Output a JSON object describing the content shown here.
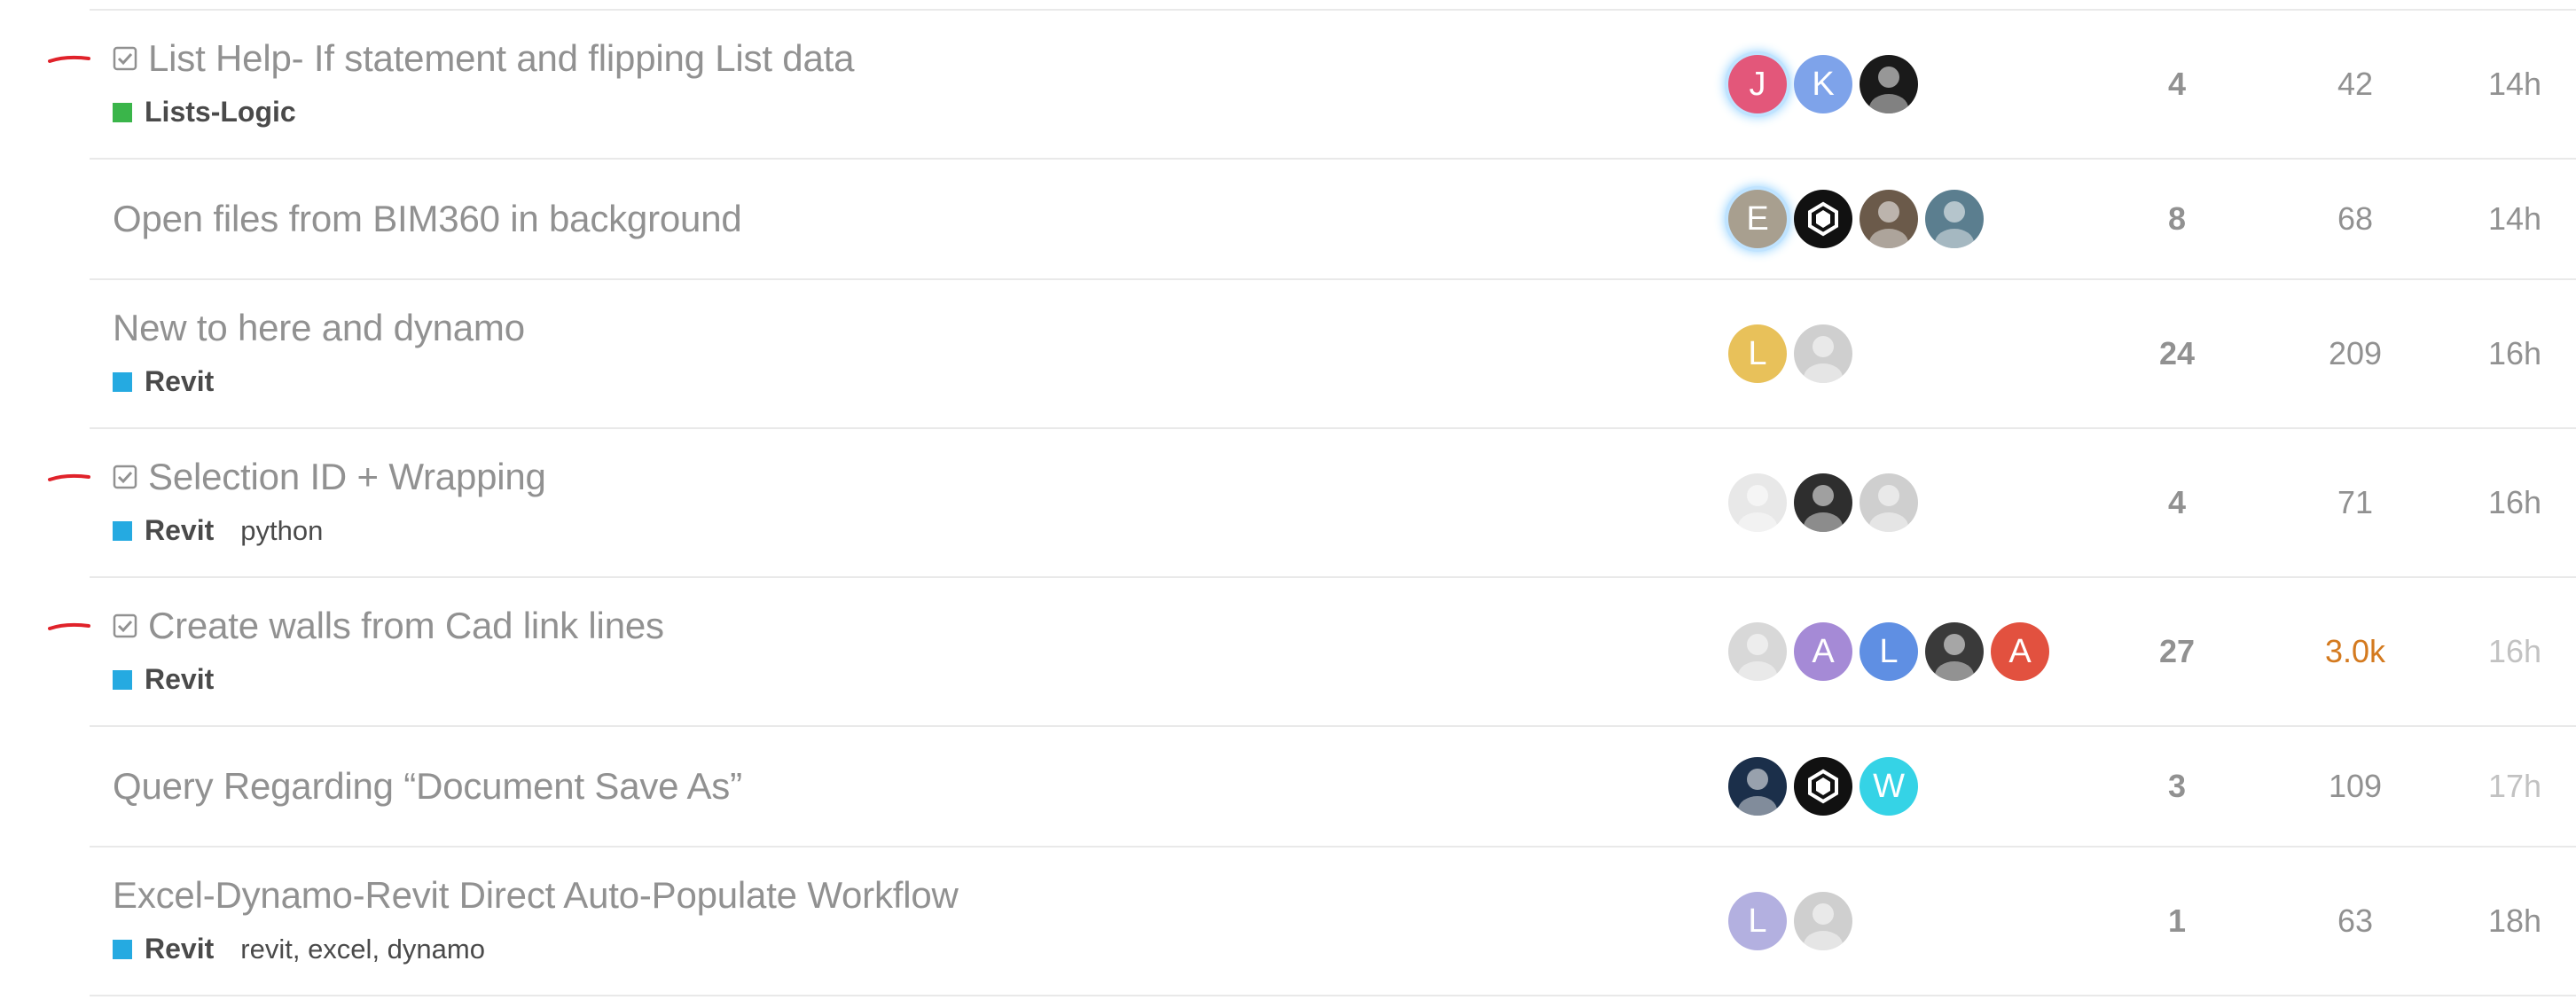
{
  "topics": [
    {
      "title": "List Help- If statement and flipping List data",
      "solved": true,
      "marked": true,
      "category": {
        "name": "Lists-Logic",
        "color": "#3ab54a"
      },
      "tags": [],
      "posters": [
        {
          "initial": "J",
          "bg": "#e3577a",
          "glow": true
        },
        {
          "initial": "K",
          "bg": "#7ea3ea"
        },
        {
          "initial": "",
          "bg": "#1a1a1a",
          "icon": "user-photo-icon"
        }
      ],
      "replies": "4",
      "views": "42",
      "activity": "14h"
    },
    {
      "title": "Open files from BIM360 in background",
      "solved": false,
      "marked": false,
      "category": null,
      "tags": [],
      "posters": [
        {
          "initial": "E",
          "bg": "#a89f8f",
          "glow": true
        },
        {
          "initial": "",
          "bg": "#111111",
          "icon": "hexagon-logo-icon"
        },
        {
          "initial": "",
          "bg": "#6b5a4a",
          "icon": "user-photo-icon"
        },
        {
          "initial": "",
          "bg": "#5b7e8f",
          "icon": "user-photo-icon"
        }
      ],
      "replies": "8",
      "views": "68",
      "activity": "14h"
    },
    {
      "title": "New to here and dynamo",
      "solved": false,
      "marked": false,
      "category": {
        "name": "Revit",
        "color": "#25aae1"
      },
      "tags": [],
      "posters": [
        {
          "initial": "L",
          "bg": "#e8c15a"
        },
        {
          "initial": "",
          "bg": "#cfcfcf",
          "icon": "user-photo-icon"
        }
      ],
      "replies": "24",
      "views": "209",
      "activity": "16h"
    },
    {
      "title": "Selection ID + Wrapping",
      "solved": true,
      "marked": true,
      "category": {
        "name": "Revit",
        "color": "#25aae1"
      },
      "tags": [
        "python"
      ],
      "posters": [
        {
          "initial": "",
          "bg": "#e8e8e8",
          "icon": "user-photo-icon"
        },
        {
          "initial": "",
          "bg": "#2e2e2e",
          "icon": "user-photo-icon"
        },
        {
          "initial": "",
          "bg": "#cfcfcf",
          "icon": "user-photo-icon"
        }
      ],
      "replies": "4",
      "views": "71",
      "activity": "16h"
    },
    {
      "title": "Create walls from Cad link lines",
      "solved": true,
      "marked": true,
      "category": {
        "name": "Revit",
        "color": "#25aae1"
      },
      "tags": [],
      "posters": [
        {
          "initial": "",
          "bg": "#d8d8d8",
          "icon": "user-photo-icon"
        },
        {
          "initial": "A",
          "bg": "#a58ad6"
        },
        {
          "initial": "L",
          "bg": "#5f8fe3"
        },
        {
          "initial": "",
          "bg": "#3a3a3a",
          "icon": "user-photo-icon"
        },
        {
          "initial": "A",
          "bg": "#e2513f"
        }
      ],
      "replies": "27",
      "views": "3.0k",
      "views_hot": true,
      "activity": "16h",
      "activity_old": true
    },
    {
      "title": "Query Regarding “Document Save As”",
      "solved": false,
      "marked": false,
      "category": null,
      "tags": [],
      "posters": [
        {
          "initial": "",
          "bg": "#1b2f4a",
          "icon": "user-photo-icon"
        },
        {
          "initial": "",
          "bg": "#111111",
          "icon": "hexagon-logo-icon"
        },
        {
          "initial": "W",
          "bg": "#35d3e6"
        }
      ],
      "replies": "3",
      "views": "109",
      "activity": "17h",
      "activity_old": true
    },
    {
      "title": "Excel-Dynamo-Revit Direct Auto-Populate Workflow",
      "solved": false,
      "marked": false,
      "category": {
        "name": "Revit",
        "color": "#25aae1"
      },
      "tags": [
        "revit",
        "excel",
        "dynamo"
      ],
      "posters": [
        {
          "initial": "L",
          "bg": "#b3b0e0"
        },
        {
          "initial": "",
          "bg": "#cfcfcf",
          "icon": "user-photo-icon"
        }
      ],
      "replies": "1",
      "views": "63",
      "activity": "18h"
    }
  ]
}
